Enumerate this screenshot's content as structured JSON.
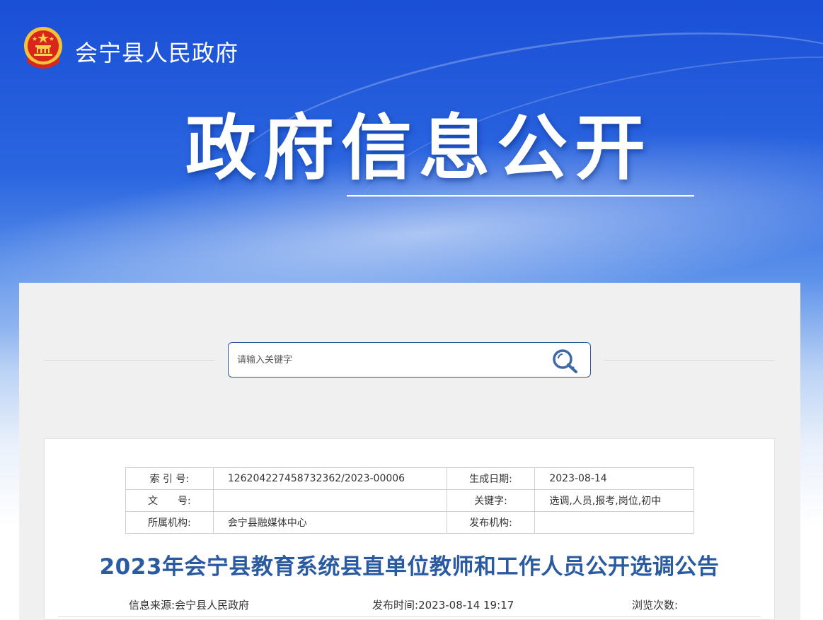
{
  "header": {
    "site_name": "会宁县人民政府",
    "hero_title": "政府信息公开"
  },
  "search": {
    "placeholder": "请输入关键字"
  },
  "meta_table": {
    "index_label": "索 引 号:",
    "index_value": "126204227458732362/2023-00006",
    "date_label": "生成日期:",
    "date_value": "2023-08-14",
    "docno_label": "文　　号:",
    "docno_value": "",
    "keywords_label": "关键字:",
    "keywords_value": "选调,人员,报考,岗位,初中",
    "org_label": "所属机构:",
    "org_value": "会宁县融媒体中心",
    "publisher_label": "发布机构:",
    "publisher_value": ""
  },
  "article": {
    "title": "2023年会宁县教育系统县直单位教师和工作人员公开选调公告",
    "source_label": "信息来源:",
    "source_value": "会宁县人民政府",
    "time_label": "发布时间:",
    "time_value": "2023-08-14 19:17",
    "views_label": "浏览次数:"
  },
  "colors": {
    "brand_blue": "#2a5aa0",
    "banner_blue": "#1a4fd6"
  }
}
